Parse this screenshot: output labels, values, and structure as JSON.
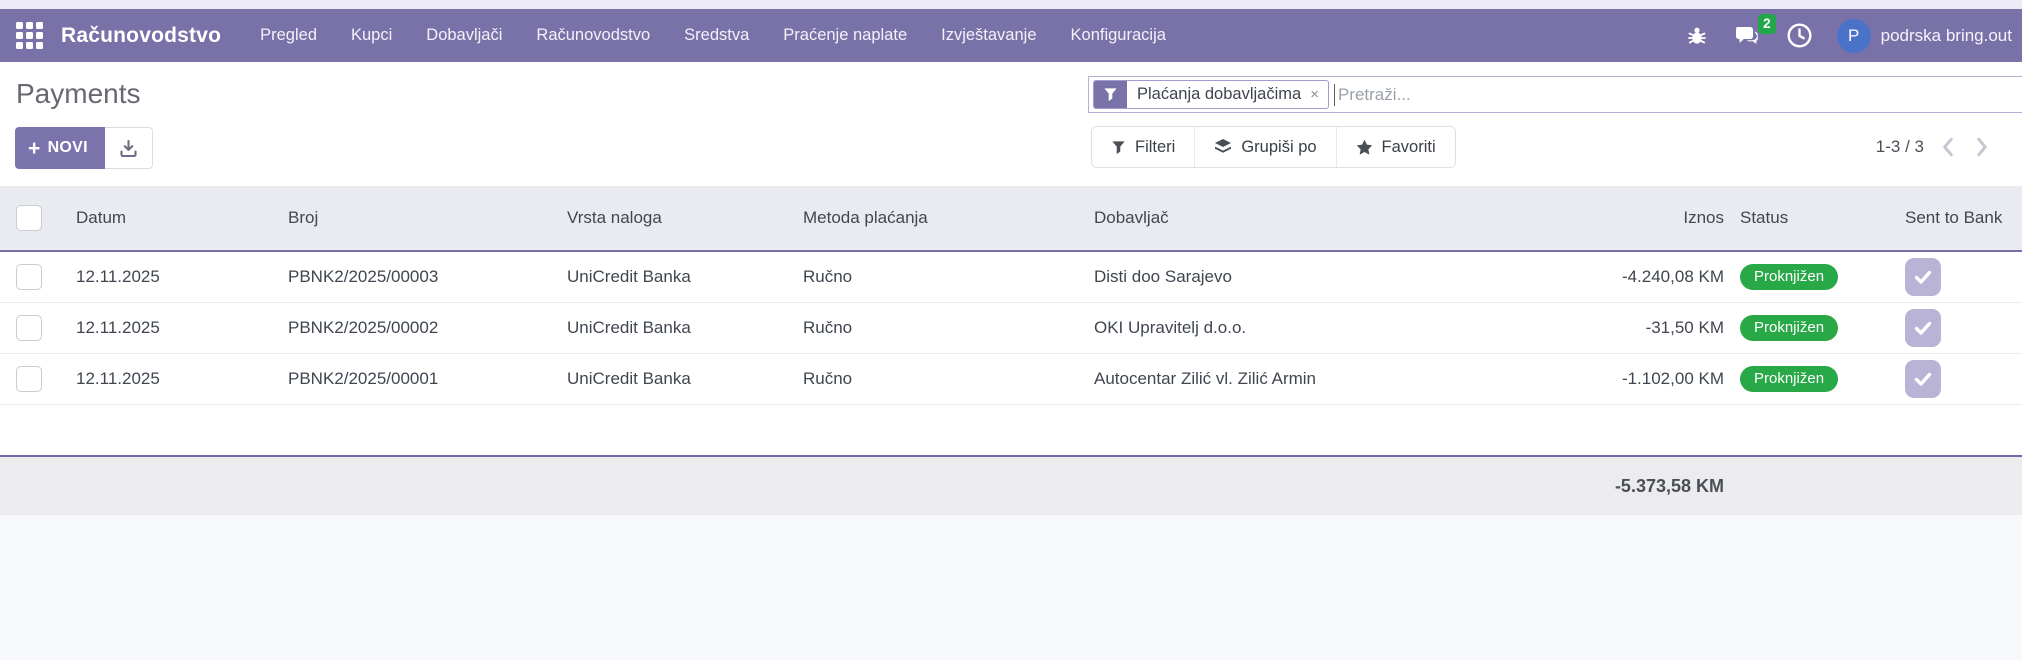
{
  "topbar": {
    "brand": "Računovodstvo",
    "menus": {
      "pregled": "Pregled",
      "kupci": "Kupci",
      "dobavljaci": "Dobavljači",
      "racunovodstvo": "Računovodstvo",
      "sredstva": "Sredstva",
      "pracenje": "Praćenje naplate",
      "izvjestavanje": "Izvještavanje",
      "konfiguracija": "Konfiguracija"
    },
    "message_count": "2",
    "user": {
      "initial": "P",
      "name": "podrska bring.out"
    }
  },
  "control_panel": {
    "title": "Payments",
    "new_button": "NOVI",
    "search": {
      "facet": "Plaćanja dobavljačima",
      "facet_remove": "×",
      "placeholder": "Pretraži..."
    },
    "buttons": {
      "filters": "Filteri",
      "group_by": "Grupiši po",
      "favorites": "Favoriti"
    },
    "pager": {
      "range": "1-3 / 3"
    }
  },
  "table": {
    "columns": {
      "datum": "Datum",
      "broj": "Broj",
      "vrsta": "Vrsta naloga",
      "metoda": "Metoda plaćanja",
      "dobavljac": "Dobavljač",
      "iznos": "Iznos",
      "status": "Status",
      "sent": "Sent to Bank"
    },
    "rows": [
      {
        "datum": "12.11.2025",
        "broj": "PBNK2/2025/00003",
        "vrsta": "UniCredit Banka",
        "metoda": "Ručno",
        "dobavljac": "Disti doo Sarajevo",
        "iznos": "-4.240,08 KM",
        "status": "Proknjižen",
        "sent": "checked"
      },
      {
        "datum": "12.11.2025",
        "broj": "PBNK2/2025/00002",
        "vrsta": "UniCredit Banka",
        "metoda": "Ručno",
        "dobavljac": "OKI Upravitelj d.o.o.",
        "iznos": "-31,50 KM",
        "status": "Proknjižen",
        "sent": "checked"
      },
      {
        "datum": "12.11.2025",
        "broj": "PBNK2/2025/00001",
        "vrsta": "UniCredit Banka",
        "metoda": "Ručno",
        "dobavljac": "Autocentar Zilić vl. Zilić Armin",
        "iznos": "-1.102,00 KM",
        "status": "Proknjižen",
        "sent": "checked"
      }
    ],
    "total": "-5.373,58 KM"
  },
  "colors": {
    "navbar_purple": "#7972a8",
    "primary_button": "#7b73ac",
    "status_green": "#29a847",
    "sent_lavender": "#b9b3d6",
    "avatar_blue": "#4a72c8",
    "header_bg": "#e9ebf0",
    "header_border": "#7570a8",
    "footer_bg": "#ececee"
  }
}
